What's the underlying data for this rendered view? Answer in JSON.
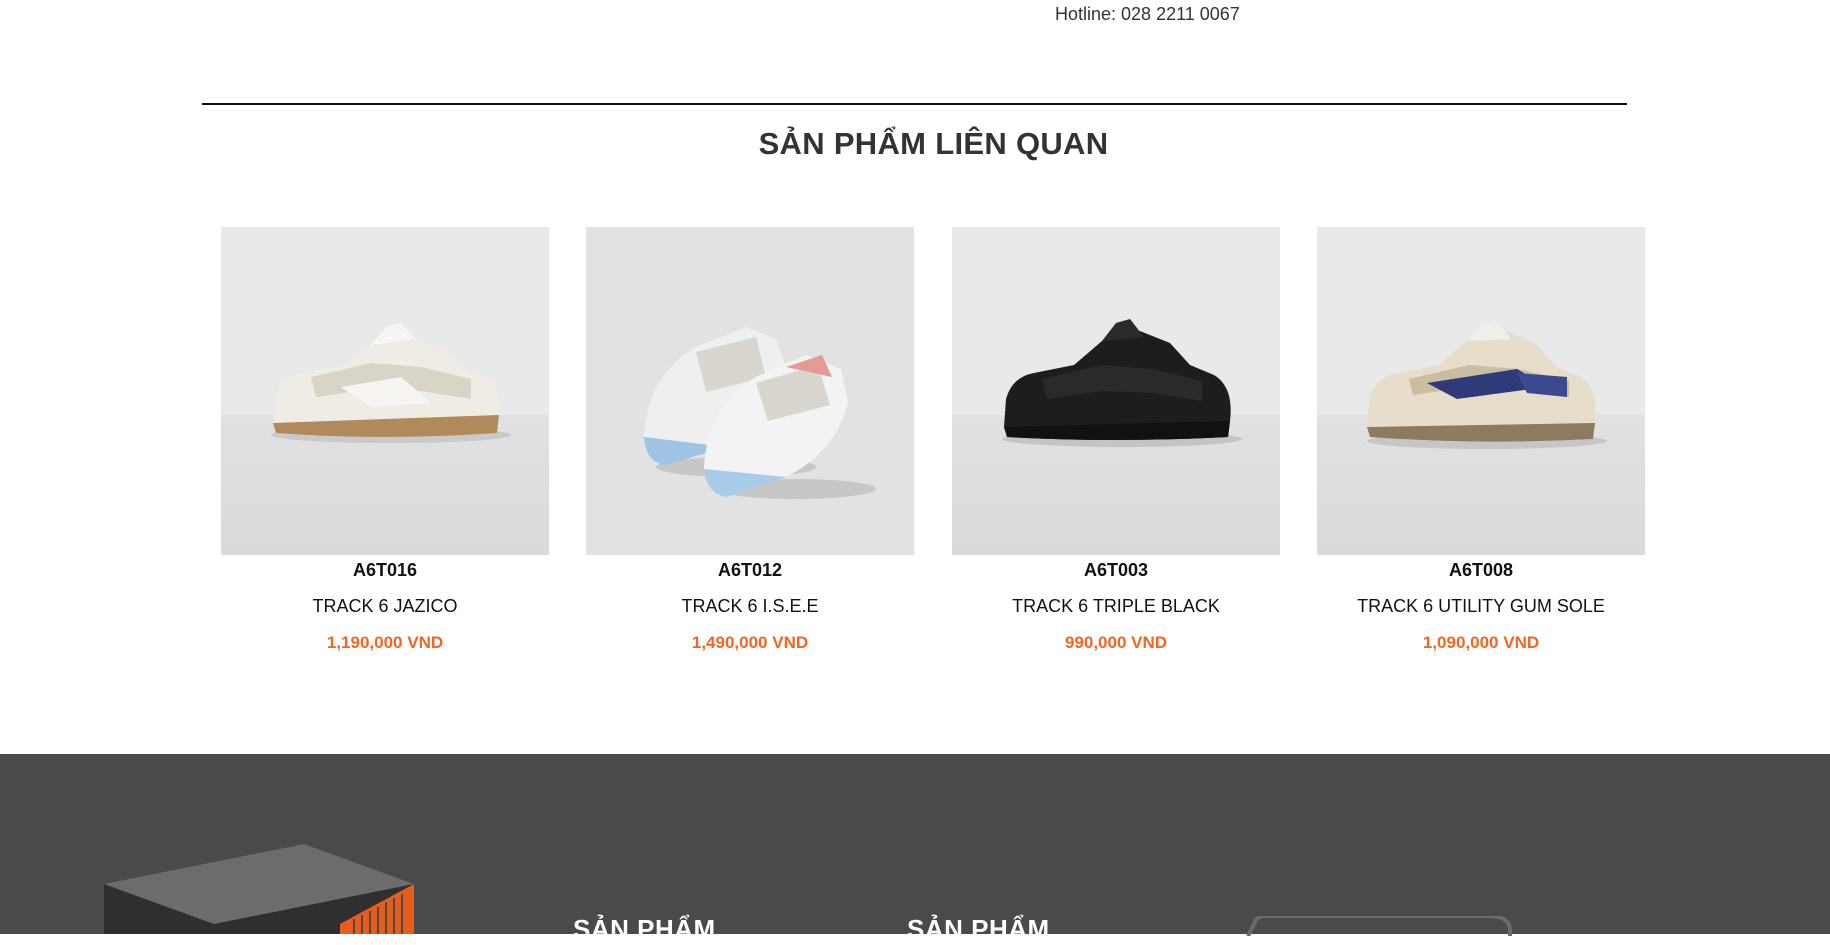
{
  "header": {
    "hotline": "Hotline: 028 2211 0067"
  },
  "related": {
    "title": "SẢN PHẨM LIÊN QUAN",
    "products": [
      {
        "code": "A6T016",
        "name": "TRACK 6 JAZICO",
        "price": "1,190,000 VND"
      },
      {
        "code": "A6T012",
        "name": "TRACK 6 I.S.E.E",
        "price": "1,490,000 VND"
      },
      {
        "code": "A6T003",
        "name": "TRACK 6 TRIPLE BLACK",
        "price": "990,000 VND"
      },
      {
        "code": "A6T008",
        "name": "TRACK 6 UTILITY GUM SOLE",
        "price": "1,090,000 VND"
      }
    ]
  },
  "footer": {
    "columns": [
      {
        "title": "SẢN PHẨM"
      },
      {
        "title": "SẢN PHẨM"
      }
    ]
  },
  "colors": {
    "price": "#f26522",
    "footer_bg": "#4a4a4a",
    "divider": "#111111"
  }
}
